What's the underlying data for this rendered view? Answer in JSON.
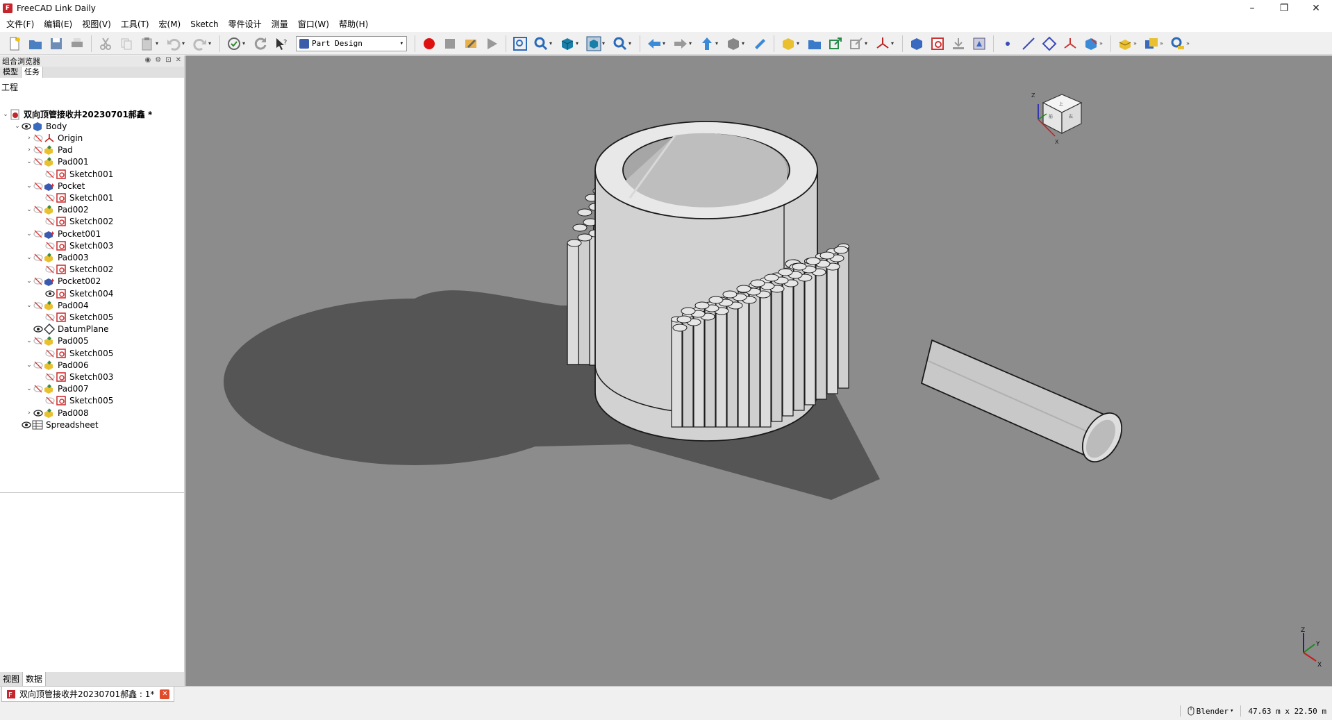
{
  "window": {
    "title": "FreeCAD Link Daily",
    "controls": {
      "minimize": "–",
      "maximize": "❐",
      "close": "✕"
    }
  },
  "menu": [
    "文件(F)",
    "编辑(E)",
    "视图(V)",
    "工具(T)",
    "宏(M)",
    "Sketch",
    "零件设计",
    "测量",
    "窗口(W)",
    "帮助(H)"
  ],
  "toolbar": {
    "workbench": "Part Design"
  },
  "left_panel": {
    "header": "组合浏览器",
    "tabs": [
      "模型",
      "任务"
    ],
    "section_label": "工程",
    "bottom_tabs": [
      "视图",
      "数据"
    ],
    "tree": [
      {
        "label": "双向顶管接收井20230701郝鑫 *",
        "level": 0,
        "expander": "⌄",
        "icon": "document-icon",
        "visible": null,
        "bold": true
      },
      {
        "label": "Body",
        "level": 1,
        "expander": "⌄",
        "icon": "body-icon",
        "visible": true
      },
      {
        "label": "Origin",
        "level": 2,
        "expander": "›",
        "icon": "origin-icon",
        "visible": false
      },
      {
        "label": "Pad",
        "level": 2,
        "expander": "›",
        "icon": "pad-icon",
        "visible": false
      },
      {
        "label": "Pad001",
        "level": 2,
        "expander": "⌄",
        "icon": "pad-icon",
        "visible": false
      },
      {
        "label": "Sketch001",
        "level": 3,
        "expander": "",
        "icon": "sketch-icon",
        "visible": false
      },
      {
        "label": "Pocket",
        "level": 2,
        "expander": "⌄",
        "icon": "pocket-icon",
        "visible": false
      },
      {
        "label": "Sketch001",
        "level": 3,
        "expander": "",
        "icon": "sketch-icon",
        "visible": false
      },
      {
        "label": "Pad002",
        "level": 2,
        "expander": "⌄",
        "icon": "pad-icon",
        "visible": false
      },
      {
        "label": "Sketch002",
        "level": 3,
        "expander": "",
        "icon": "sketch-icon",
        "visible": false
      },
      {
        "label": "Pocket001",
        "level": 2,
        "expander": "⌄",
        "icon": "pocket-icon",
        "visible": false
      },
      {
        "label": "Sketch003",
        "level": 3,
        "expander": "",
        "icon": "sketch-icon",
        "visible": false
      },
      {
        "label": "Pad003",
        "level": 2,
        "expander": "⌄",
        "icon": "pad-icon",
        "visible": false
      },
      {
        "label": "Sketch002",
        "level": 3,
        "expander": "",
        "icon": "sketch-icon",
        "visible": false
      },
      {
        "label": "Pocket002",
        "level": 2,
        "expander": "⌄",
        "icon": "pocket-icon",
        "visible": false
      },
      {
        "label": "Sketch004",
        "level": 3,
        "expander": "",
        "icon": "sketch-icon",
        "visible": true
      },
      {
        "label": "Pad004",
        "level": 2,
        "expander": "⌄",
        "icon": "pad-icon",
        "visible": false
      },
      {
        "label": "Sketch005",
        "level": 3,
        "expander": "",
        "icon": "sketch-icon",
        "visible": false
      },
      {
        "label": "DatumPlane",
        "level": 2,
        "expander": "",
        "icon": "datum-plane-icon",
        "visible": true
      },
      {
        "label": "Pad005",
        "level": 2,
        "expander": "⌄",
        "icon": "pad-icon",
        "visible": false
      },
      {
        "label": "Sketch005",
        "level": 3,
        "expander": "",
        "icon": "sketch-icon",
        "visible": false
      },
      {
        "label": "Pad006",
        "level": 2,
        "expander": "⌄",
        "icon": "pad-icon",
        "visible": false
      },
      {
        "label": "Sketch003",
        "level": 3,
        "expander": "",
        "icon": "sketch-icon",
        "visible": false
      },
      {
        "label": "Pad007",
        "level": 2,
        "expander": "⌄",
        "icon": "pad-icon",
        "visible": false
      },
      {
        "label": "Sketch005",
        "level": 3,
        "expander": "",
        "icon": "sketch-icon",
        "visible": false
      },
      {
        "label": "Pad008",
        "level": 2,
        "expander": "›",
        "icon": "pad-icon",
        "visible": true
      },
      {
        "label": "Spreadsheet",
        "level": 1,
        "expander": "",
        "icon": "spreadsheet-icon",
        "visible": true
      }
    ]
  },
  "navcube": {
    "z_label": "Z",
    "x_label": "X",
    "faces": [
      "上",
      "前",
      "右"
    ]
  },
  "axis_indicator": {
    "z": "Z",
    "y": "Y",
    "x": "X"
  },
  "document_tab": {
    "label": "双向顶管接收井20230701郝鑫 : 1*",
    "close": "✕"
  },
  "status": {
    "nav_style": "Blender",
    "dimensions": "47.63 m x 22.50 m"
  },
  "colors": {
    "viewport_bg": "#8c8c8c",
    "shadow": "#555555",
    "model": "#d2d2d2",
    "model_edge": "#1a1a1a"
  }
}
